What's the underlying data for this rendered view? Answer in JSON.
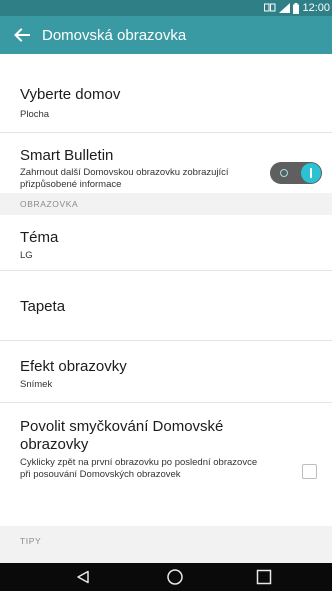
{
  "status_bar": {
    "time": "12:00",
    "icons": [
      "dual-sim-icon",
      "signal-icon",
      "battery-icon"
    ]
  },
  "app_bar": {
    "title": "Domovská obrazovka",
    "back_icon": "arrow-left-icon"
  },
  "settings": [
    {
      "title": "Vyberte domov",
      "subtitle": "Plocha"
    },
    {
      "title": "Smart Bulletin",
      "subtitle": "Zahrnout další Domovskou obrazovku zobrazující přizpůsobené informace",
      "toggle_on": true
    },
    {
      "section": "OBRAZOVKA"
    },
    {
      "title": "Téma",
      "subtitle": "LG"
    },
    {
      "title": "Tapeta"
    },
    {
      "title": "Efekt obrazovky",
      "subtitle": "Snímek"
    },
    {
      "title": "Povolit smyčkování Domovské obrazovky",
      "subtitle": "Cyklicky zpět na první obrazovku po poslední obrazovce při posouvání Domovských obrazovek",
      "checked": false
    },
    {
      "section": "TIPY"
    }
  ],
  "nav_bar": {
    "buttons": [
      "back-triangle-icon",
      "home-circle-icon",
      "recents-square-icon"
    ]
  },
  "colors": {
    "status_bar": "#2f7f87",
    "app_bar": "#3a9aa3",
    "toggle_accent": "#2bc3d3",
    "section_bg": "#f2f2f2"
  }
}
